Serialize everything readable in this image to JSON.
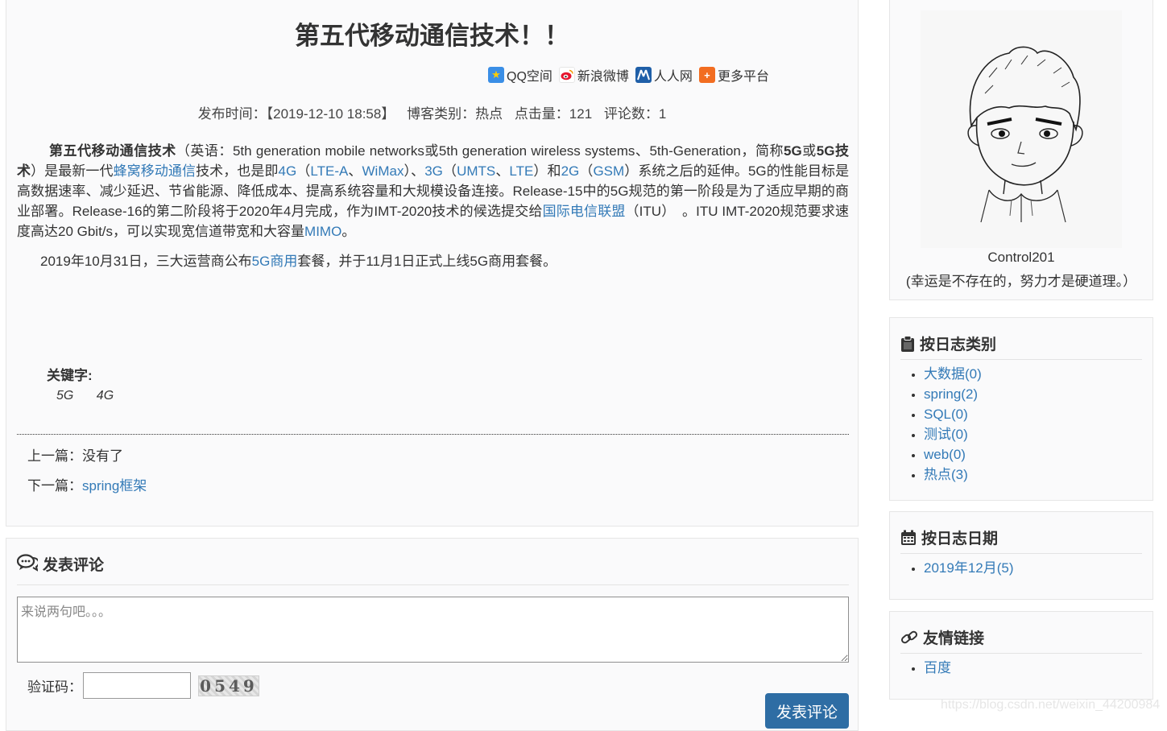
{
  "article": {
    "title": "第五代移动通信技术！！",
    "share": [
      {
        "label": "QQ空间",
        "icon": "qzone-icon"
      },
      {
        "label": "新浪微博",
        "icon": "weibo-icon"
      },
      {
        "label": "人人网",
        "icon": "renren-icon"
      },
      {
        "label": "更多平台",
        "icon": "plus-icon"
      }
    ],
    "meta": {
      "publish": "发布时间：【2019-12-10 18:58】",
      "category": "博客类别：热点",
      "clicks": "点击量：121",
      "comments": "评论数：1"
    },
    "p1": [
      {
        "t": "第五代移动通信技术",
        "s": "b"
      },
      {
        "t": "（英语：5th generation mobile networks或5th generation wireless systems、5th-Generation，简称"
      },
      {
        "t": "5G",
        "s": "b"
      },
      {
        "t": "或"
      },
      {
        "t": "5G技术",
        "s": "b"
      },
      {
        "t": "）是最新一代"
      },
      {
        "t": "蜂窝移动通信",
        "s": "a"
      },
      {
        "t": "技术，也是即"
      },
      {
        "t": "4G",
        "s": "a"
      },
      {
        "t": "（"
      },
      {
        "t": "LTE-A",
        "s": "a"
      },
      {
        "t": "、"
      },
      {
        "t": "WiMax",
        "s": "a"
      },
      {
        "t": "）、"
      },
      {
        "t": "3G",
        "s": "a"
      },
      {
        "t": "（"
      },
      {
        "t": "UMTS",
        "s": "a"
      },
      {
        "t": "、"
      },
      {
        "t": "LTE",
        "s": "a"
      },
      {
        "t": "）和"
      },
      {
        "t": "2G",
        "s": "a"
      },
      {
        "t": "（"
      },
      {
        "t": "GSM",
        "s": "a"
      },
      {
        "t": "）系统之后的延伸。5G的性能目标是高数据速率、减少延迟、节省能源、降低成本、提高系统容量和大规模设备连接。Release-15中的5G规范的第一阶段是为了适应早期的商业部署。Release-16的第二阶段将于2020年4月完成，作为IMT-2020技术的候选提交给"
      },
      {
        "t": "国际电信联盟",
        "s": "a"
      },
      {
        "t": "（ITU）　。ITU IMT-2020规范要求速度高达20 Gbit/s，可以实现宽信道带宽和大容量"
      },
      {
        "t": "MIMO",
        "s": "a"
      },
      {
        "t": "。"
      }
    ],
    "p2": [
      {
        "t": "2019年10月31日，三大运营商公布"
      },
      {
        "t": "5G商用",
        "s": "a"
      },
      {
        "t": "套餐，并于11月1日正式上线5G商用套餐。"
      }
    ],
    "keywords_label": "关键字:",
    "keywords": [
      "5G",
      "4G"
    ],
    "prev_label": "上一篇：",
    "prev_value": "没有了",
    "next_label": "下一篇：",
    "next_value": "spring框架"
  },
  "comment": {
    "heading": "发表评论",
    "placeholder": "来说两句吧。。。",
    "captcha_label": "验证码：",
    "captcha_text": "0549",
    "submit_label": "发表评论"
  },
  "profile": {
    "name": "Control201",
    "motto": "(幸运是不存在的，努力才是硬道理。）"
  },
  "categories": {
    "heading": "按日志类别",
    "items": [
      "大数据(0)",
      "spring(2)",
      "SQL(0)",
      "测试(0)",
      "web(0)",
      "热点(3)"
    ]
  },
  "dates": {
    "heading": "按日志日期",
    "items": [
      "2019年12月(5)"
    ]
  },
  "links": {
    "heading": "友情链接",
    "items": [
      "百度"
    ]
  },
  "watermark": "https://blog.csdn.net/weixin_44200984",
  "colors": {
    "link": "#337ab7",
    "button": "#2e6da4",
    "panel": "#fafafb"
  }
}
